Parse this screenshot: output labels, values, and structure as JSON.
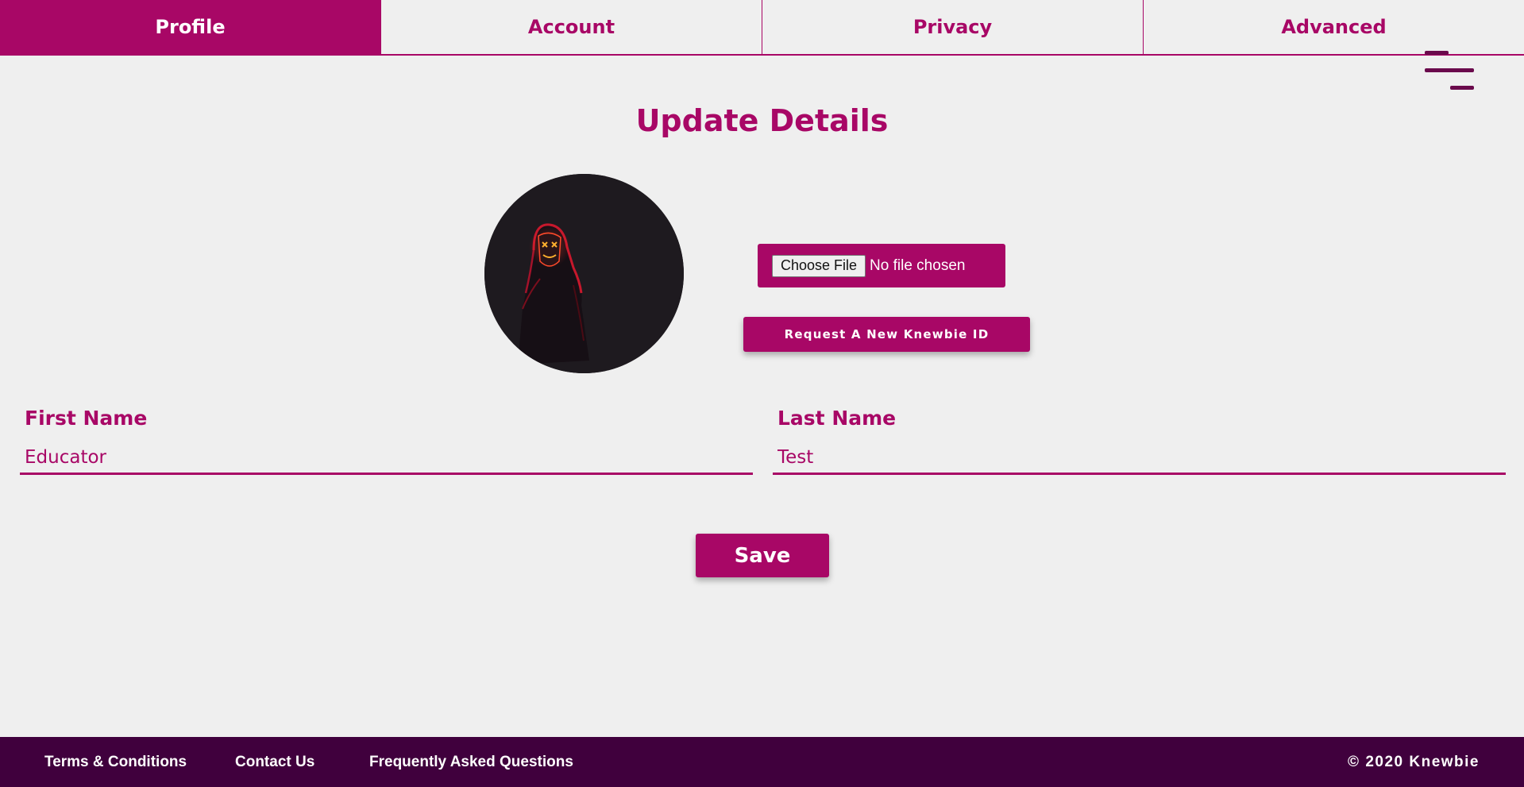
{
  "tabs": [
    {
      "label": "Profile",
      "active": true
    },
    {
      "label": "Account",
      "active": false
    },
    {
      "label": "Privacy",
      "active": false
    },
    {
      "label": "Advanced",
      "active": false
    }
  ],
  "menu": {
    "icon": "hamburger-menu-icon"
  },
  "page": {
    "title": "Update Details"
  },
  "avatar": {
    "alt_icon": "profile-photo"
  },
  "file_upload": {
    "button_label": "Choose File",
    "status": "No file chosen"
  },
  "request_button": {
    "label": "Request A New Knewbie ID"
  },
  "form": {
    "first_name": {
      "label": "First Name",
      "value": "Educator"
    },
    "last_name": {
      "label": "Last Name",
      "value": "Test"
    }
  },
  "save_button": {
    "label": "Save"
  },
  "footer": {
    "links": [
      "Terms & Conditions",
      "Contact Us",
      "Frequently Asked Questions"
    ],
    "copyright": "© 2020 Knewbie"
  },
  "colors": {
    "primary": "#a80766",
    "footer_bg": "#40003d",
    "background": "#efefef"
  }
}
